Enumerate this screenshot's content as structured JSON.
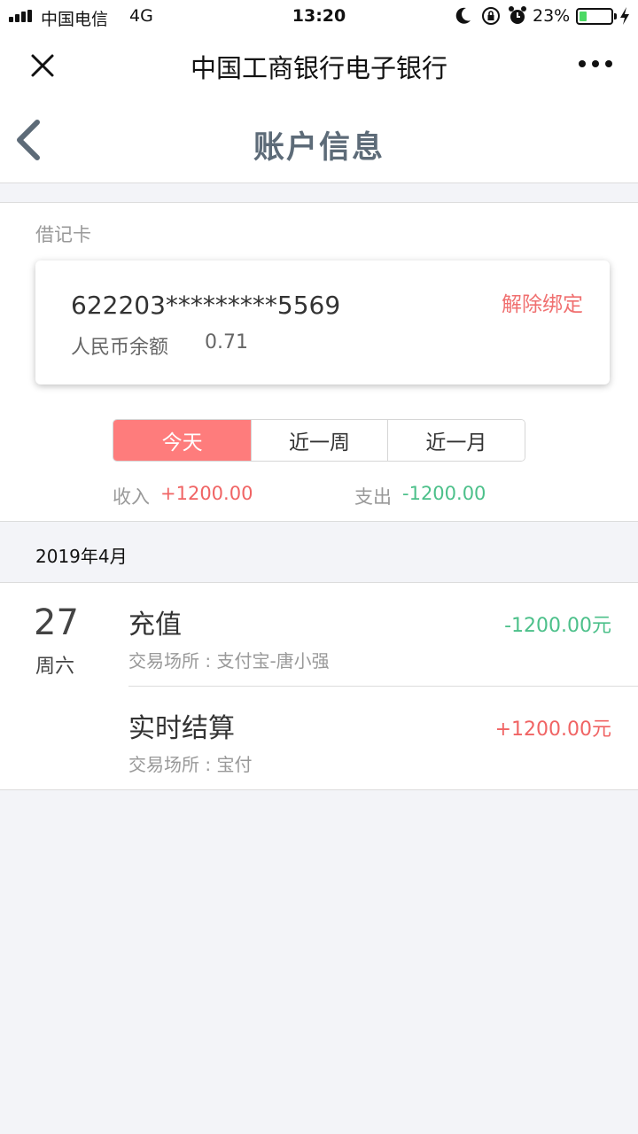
{
  "status_bar": {
    "carrier": "中国电信",
    "network": "4G",
    "time": "13:20",
    "battery_percent": "23%",
    "battery_level": 0.23,
    "icons": [
      "signal-icon",
      "moon-icon",
      "rotation-lock-icon",
      "alarm-icon",
      "battery-icon",
      "charging-bolt-icon"
    ]
  },
  "nav": {
    "title": "中国工商银行电子银行"
  },
  "header": {
    "title": "账户信息"
  },
  "account": {
    "card_type": "借记卡",
    "card_number": "622203*********5569",
    "unbind_label": "解除绑定",
    "balance_label": "人民币余额",
    "balance_value": "0.71"
  },
  "period_tabs": [
    "今天",
    "近一周",
    "近一月"
  ],
  "summary": {
    "income_label": "收入",
    "income_value": "+1200.00",
    "expense_label": "支出",
    "expense_value": "-1200.00"
  },
  "month": "2019年4月",
  "day": {
    "date": "27",
    "weekday": "周六"
  },
  "transactions": [
    {
      "name": "充值",
      "place": "交易场所 : 支付宝-唐小强",
      "amount": "-1200.00元"
    },
    {
      "name": "实时结算",
      "place": "交易场所 : 宝付",
      "amount": "+1200.00元"
    }
  ],
  "colors": {
    "accent": "#fe7c7c",
    "income": "#f06464",
    "expense": "#4cc08a",
    "header_title": "#5d6b78",
    "background": "#f3f4f8"
  }
}
